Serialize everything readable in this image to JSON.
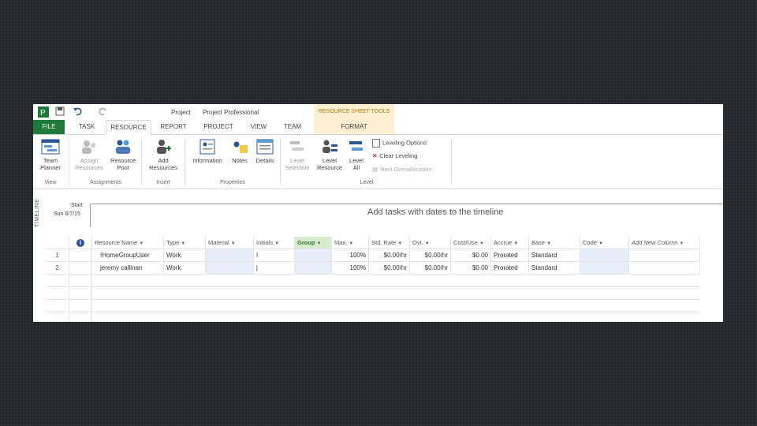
{
  "title": {
    "app": "Project",
    "product": "Project Professional"
  },
  "contextual_header": "RESOURCE SHEET TOOLS",
  "tabs": [
    "FILE",
    "TASK",
    "RESOURCE",
    "REPORT",
    "PROJECT",
    "VIEW",
    "TEAM",
    "FORMAT"
  ],
  "ribbon": {
    "team_planner": "Team Planner",
    "assign_resources": "Assign Resources",
    "resource_pool": "Resource Pool",
    "add_resources": "Add Resources",
    "information": "Information",
    "notes": "Notes",
    "details": "Details",
    "level_selection": "Level Selection",
    "level_resource": "Level Resource",
    "level_all": "Level All",
    "leveling_options": "Leveling Options",
    "clear_leveling": "Clear Leveling",
    "next_overallocation": "Next Overallocation",
    "groups": {
      "view": "View",
      "assignments": "Assignments",
      "insert": "Insert",
      "properties": "Properties",
      "level": "Level"
    }
  },
  "timeline": {
    "label": "TIMELINE",
    "start_label": "Start",
    "start_date": "Sun 6/7/15",
    "message": "Add tasks with dates to the timeline"
  },
  "sheet": {
    "headers": [
      "Resource Name",
      "Type",
      "Material",
      "Initials",
      "Group",
      "Max.",
      "Std. Rate",
      "Ovt.",
      "Cost/Use",
      "Accrue",
      "Base",
      "Code",
      "Add New Column"
    ],
    "rows": [
      {
        "id": "1",
        "name": "IHomeGroupUser",
        "type": "Work",
        "material": "",
        "initials": "I",
        "group": "",
        "max": "100%",
        "std_rate": "$0.00/hr",
        "ovt": "$0.00/hr",
        "cost_use": "$0.00",
        "accrue": "Prorated",
        "base": "Standard",
        "code": ""
      },
      {
        "id": "2",
        "name": "jeremy callinan",
        "type": "Work",
        "material": "",
        "initials": "j",
        "group": "",
        "max": "100%",
        "std_rate": "$0.00/hr",
        "ovt": "$0.00/hr",
        "cost_use": "$0.00",
        "accrue": "Prorated",
        "base": "Standard",
        "code": ""
      }
    ]
  },
  "colors": {
    "file_tab": "#1f7a3a",
    "contextual": "#fdf0d2",
    "selection": "#e8eef9"
  }
}
